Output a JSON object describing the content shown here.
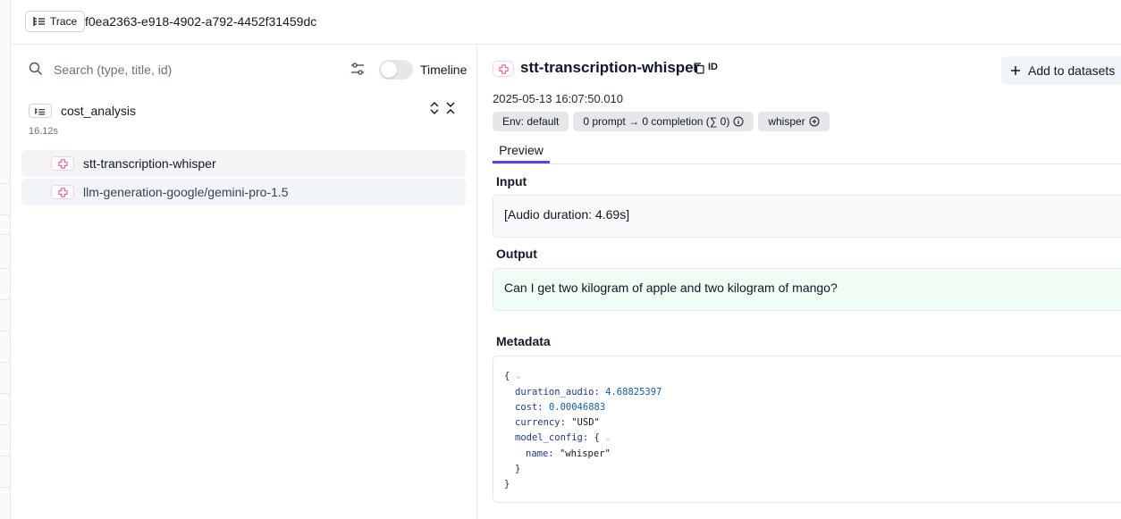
{
  "header": {
    "badge_label": "Trace",
    "trace_id": "f0ea2363-e918-4902-a792-4452f31459dc"
  },
  "left": {
    "search_placeholder": "Search (type, title, id)",
    "timeline_label": "Timeline",
    "timeline_enabled": false,
    "trace_name": "cost_analysis",
    "trace_duration": "16.12s",
    "observations": [
      {
        "label": "stt-transcription-whisper"
      },
      {
        "label": "llm-generation-google/gemini-pro-1.5"
      }
    ]
  },
  "detail": {
    "title": "stt-transcription-whisper",
    "id_label": "ID",
    "add_datasets_label": "Add to datasets",
    "timestamp": "2025-05-13 16:07:50.010",
    "badges": {
      "env": "Env: default",
      "tokens": "0 prompt → 0 completion (∑ 0)",
      "model": "whisper"
    },
    "tab_preview": "Preview",
    "input_title": "Input",
    "input_value": "[Audio duration: 4.69s]",
    "output_title": "Output",
    "output_value": "Can I get two kilogram of apple and two kilogram of mango?",
    "metadata_title": "Metadata",
    "metadata": {
      "open_brace": "{",
      "duration_key": "duration_audio:",
      "duration_val": "4.68825397",
      "cost_key": "cost:",
      "cost_val": "0.00046883",
      "currency_key": "currency:",
      "currency_val": "\"USD\"",
      "model_config_key": "model_config:",
      "model_config_open": "{",
      "name_key": "name:",
      "name_val": "\"whisper\"",
      "inner_close": "}",
      "close_brace": "}"
    }
  },
  "colors": {
    "accent": "#4f46e5",
    "generation_icon": "#ec4899",
    "output_bg": "#f0fdf4",
    "input_bg": "#f8fafc"
  }
}
